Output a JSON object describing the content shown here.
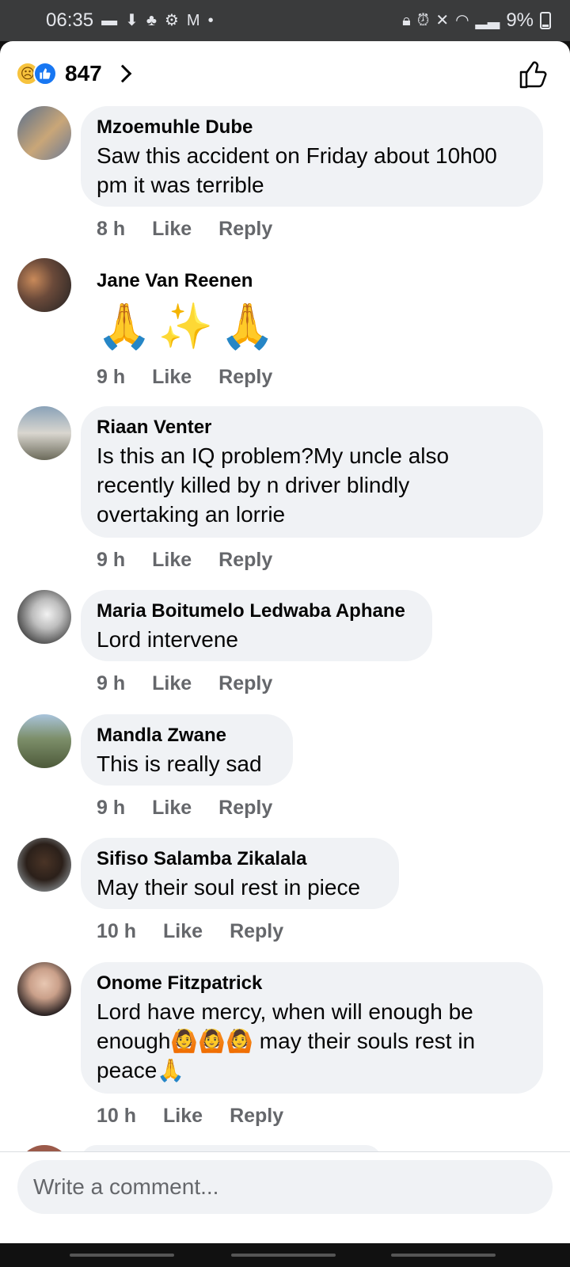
{
  "status_bar": {
    "time": "06:35",
    "battery": "9%"
  },
  "reactions": {
    "count": "847"
  },
  "comments": [
    {
      "name": "Mzoemuhle Dube",
      "text_lines": [
        "Saw this accident on Friday about 10h00",
        "pm it was terrible"
      ],
      "time": "8 h"
    },
    {
      "name": "Jane Van Reenen",
      "text_lines": [],
      "emoji": [
        "🙏",
        "✨",
        "🙏"
      ],
      "time": "9 h"
    },
    {
      "name": "Riaan Venter",
      "text_lines": [
        "Is this an IQ problem?My uncle also",
        "recently killed by n driver blindly",
        "overtaking an lorrie"
      ],
      "time": "9 h"
    },
    {
      "name": "Maria Boitumelo Ledwaba Aphane",
      "text_lines": [
        "Lord intervene"
      ],
      "time": "9 h"
    },
    {
      "name": "Mandla Zwane",
      "text_lines": [
        "This is really sad"
      ],
      "time": "9 h"
    },
    {
      "name": "Sifiso Salamba Zikalala",
      "text_lines": [
        "May their soul rest in piece"
      ],
      "time": "10 h"
    },
    {
      "name": "Onome Fitzpatrick",
      "text_lines": [
        "Lord have mercy, when will enough be",
        "enough🙆🙆🙆 may their souls rest in",
        "peace🙏"
      ],
      "time": "10 h"
    }
  ],
  "actions": {
    "like": "Like",
    "reply": "Reply"
  },
  "composer": {
    "placeholder": "Write a comment..."
  },
  "colors": {
    "bubble": "#f0f2f5",
    "meta": "#65676b",
    "like_blue": "#1877f2"
  }
}
